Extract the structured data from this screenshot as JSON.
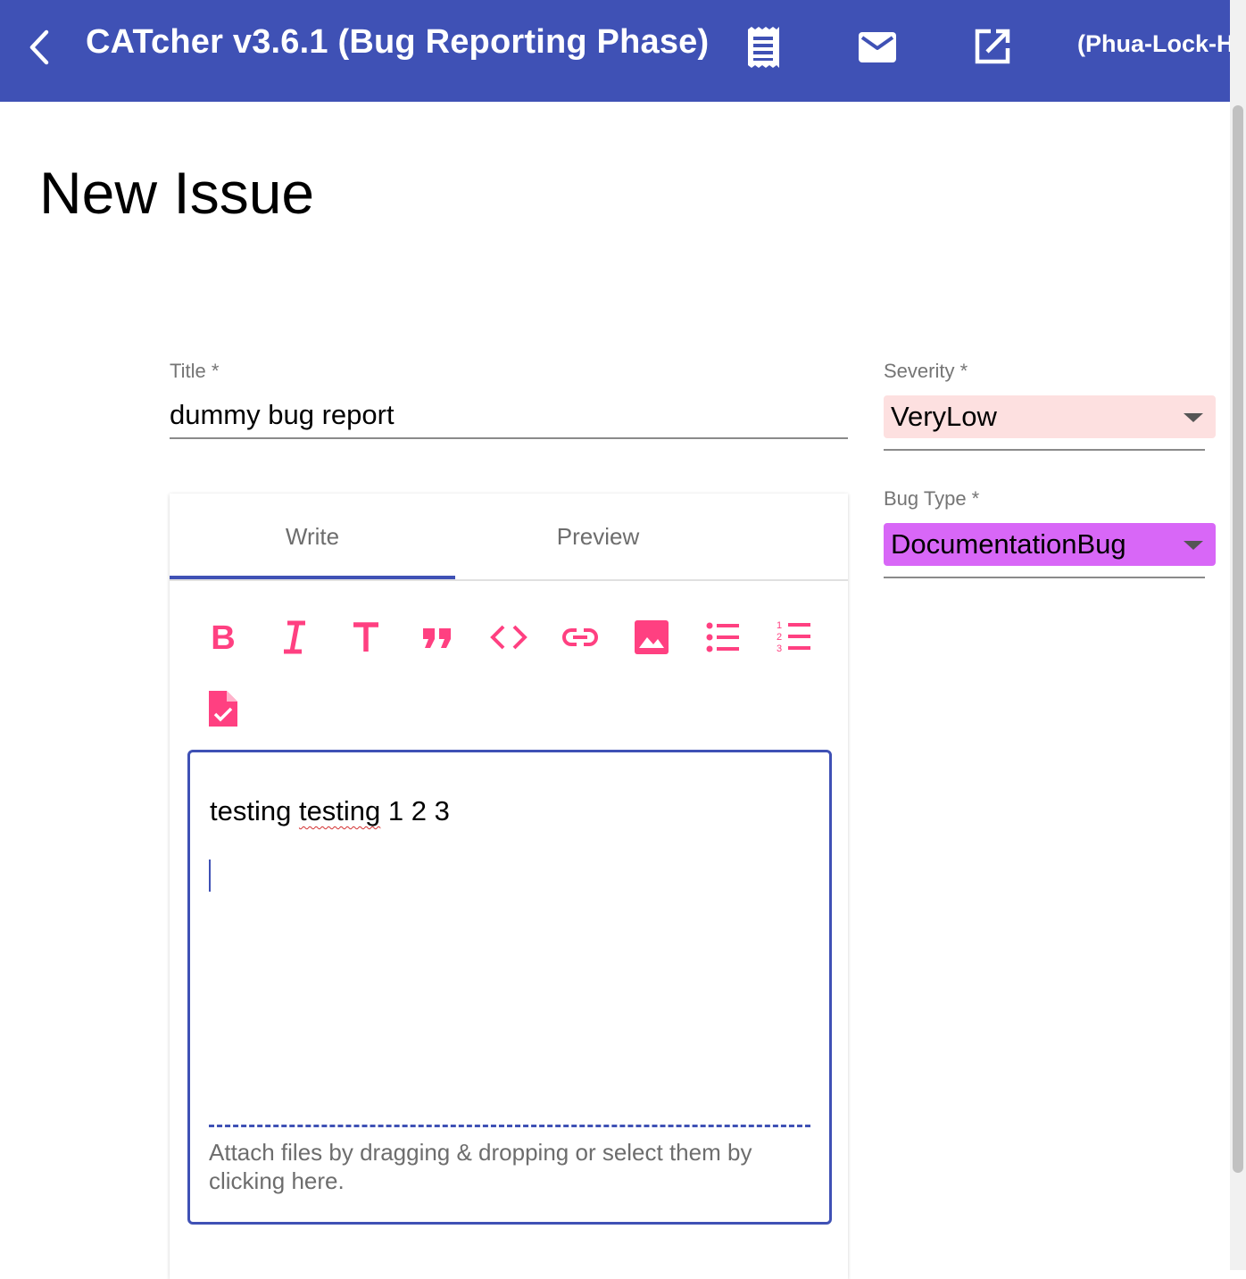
{
  "header": {
    "app_title": "CATcher v3.6.1  (Bug Reporting Phase)",
    "user": "(Phua-Lock-H",
    "icons": [
      "back-chevron-icon",
      "receipt-icon",
      "mail-icon",
      "open-in-new-icon"
    ],
    "bar_color": "#3f51b5"
  },
  "page": {
    "title": "New Issue"
  },
  "form": {
    "title_label": "Title *",
    "title_value": "dummy bug report",
    "severity_label": "Severity *",
    "severity_value": "VeryLow",
    "severity_color": "#fde0e0",
    "bug_type_label": "Bug Type *",
    "bug_type_value": "DocumentationBug",
    "bug_type_color": "#d867f7"
  },
  "editor": {
    "tabs": [
      {
        "label": "Write",
        "active": true
      },
      {
        "label": "Preview",
        "active": false
      }
    ],
    "toolbar": [
      "bold-icon",
      "italic-icon",
      "header-icon",
      "quote-icon",
      "code-icon",
      "link-icon",
      "image-icon",
      "bullet-list-icon",
      "numbered-list-icon",
      "task-list-icon"
    ],
    "toolbar_color": "#ff4081",
    "body_line1": "testing ",
    "body_misspelled": "testing",
    "body_line1_rest": " 1 2 3",
    "attach_hint": "Attach files by dragging & dropping or select them by clicking here."
  }
}
